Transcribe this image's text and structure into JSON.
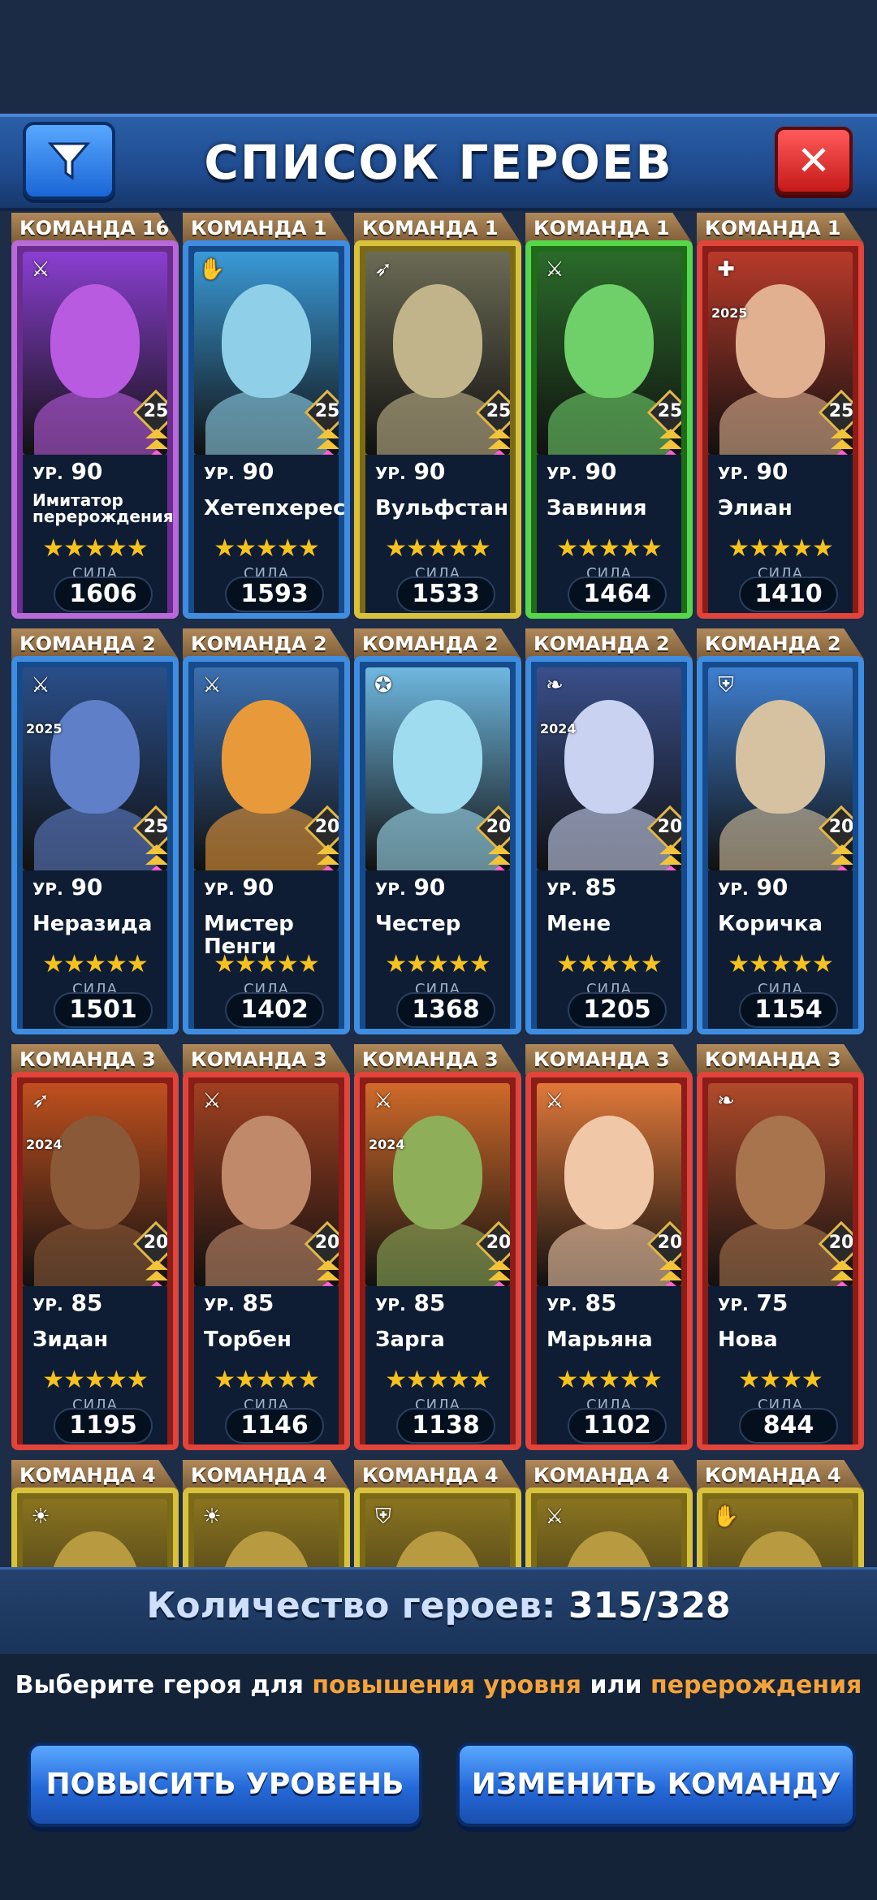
{
  "header": {
    "title": "СПИСОК ГЕРОЕВ",
    "filter_icon": "filter-funnel-icon",
    "close_label": "✕"
  },
  "heroes": [
    {
      "team": "КОМАНДА 16",
      "level": "90",
      "name": "Имитатор перерождения",
      "power": "1606",
      "stars": "★★★★★",
      "hero_level": "25",
      "frame": "legend",
      "class_icon": "⚔",
      "year": "",
      "bg": "#8a3fd1",
      "skin": "#b95be0"
    },
    {
      "team": "КОМАНДА 1",
      "level": "90",
      "name": "Хетепхерес",
      "power": "1593",
      "stars": "★★★★★",
      "hero_level": "25",
      "frame": "blue",
      "class_icon": "✋",
      "year": "",
      "bg": "#3a9ad8",
      "skin": "#8fd0e8"
    },
    {
      "team": "КОМАНДА 1",
      "level": "90",
      "name": "Вульфстан",
      "power": "1533",
      "stars": "★★★★★",
      "hero_level": "25",
      "frame": "yellow",
      "class_icon": "➶",
      "year": "",
      "bg": "#6b6b55",
      "skin": "#c2b48a"
    },
    {
      "team": "КОМАНДА 1",
      "level": "90",
      "name": "Завиния",
      "power": "1464",
      "stars": "★★★★★",
      "hero_level": "25",
      "frame": "green",
      "class_icon": "⚔",
      "year": "",
      "bg": "#2a6b2a",
      "skin": "#6fd06a"
    },
    {
      "team": "КОМАНДА 1",
      "level": "90",
      "name": "Элиан",
      "power": "1410",
      "stars": "★★★★★",
      "hero_level": "25",
      "frame": "red",
      "class_icon": "✚",
      "year": "2025",
      "bg": "#b83a2a",
      "skin": "#e0b090"
    },
    {
      "team": "КОМАНДА 2",
      "level": "90",
      "name": "Неразида",
      "power": "1501",
      "stars": "★★★★★",
      "hero_level": "25",
      "frame": "blue",
      "class_icon": "⚔",
      "year": "2025",
      "bg": "#2a4f8a",
      "skin": "#5f7fc8"
    },
    {
      "team": "КОМАНДА 2",
      "level": "90",
      "name": "Мистер Пенги",
      "power": "1402",
      "stars": "★★★★★",
      "hero_level": "20",
      "frame": "blue",
      "class_icon": "⚔",
      "year": "",
      "bg": "#3b6fb0",
      "skin": "#e89a3a"
    },
    {
      "team": "КОМАНДА 2",
      "level": "90",
      "name": "Честер",
      "power": "1368",
      "stars": "★★★★★",
      "hero_level": "20",
      "frame": "blue",
      "class_icon": "✪",
      "year": "",
      "bg": "#6fb8e0",
      "skin": "#9fdcf0"
    },
    {
      "team": "КОМАНДА 2",
      "level": "85",
      "name": "Мене",
      "power": "1205",
      "stars": "★★★★★",
      "hero_level": "20",
      "frame": "blue",
      "class_icon": "❧",
      "year": "2024",
      "bg": "#3a4f8a",
      "skin": "#c9d2f0"
    },
    {
      "team": "КОМАНДА 2",
      "level": "90",
      "name": "Коричка",
      "power": "1154",
      "stars": "★★★★★",
      "hero_level": "20",
      "frame": "blue",
      "class_icon": "⛨",
      "year": "",
      "bg": "#3f7fd0",
      "skin": "#d6c2a0"
    },
    {
      "team": "КОМАНДА 3",
      "level": "85",
      "name": "Зидан",
      "power": "1195",
      "stars": "★★★★★",
      "hero_level": "20",
      "frame": "red",
      "class_icon": "➶",
      "year": "2024",
      "bg": "#c0501e",
      "skin": "#8a5a38"
    },
    {
      "team": "КОМАНДА 3",
      "level": "85",
      "name": "Торбен",
      "power": "1146",
      "stars": "★★★★★",
      "hero_level": "20",
      "frame": "red",
      "class_icon": "⚔",
      "year": "",
      "bg": "#a04020",
      "skin": "#c08a6a"
    },
    {
      "team": "КОМАНДА 3",
      "level": "85",
      "name": "Зарга",
      "power": "1138",
      "stars": "★★★★★",
      "hero_level": "20",
      "frame": "red",
      "class_icon": "⚔",
      "year": "2024",
      "bg": "#d06a2a",
      "skin": "#8fae5a"
    },
    {
      "team": "КОМАНДА 3",
      "level": "85",
      "name": "Марьяна",
      "power": "1102",
      "stars": "★★★★★",
      "hero_level": "20",
      "frame": "red",
      "class_icon": "⚔",
      "year": "",
      "bg": "#e0783a",
      "skin": "#f0c8a8"
    },
    {
      "team": "КОМАНДА 3",
      "level": "75",
      "name": "Нова",
      "power": "844",
      "stars": "★★★★",
      "hero_level": "20",
      "frame": "red",
      "class_icon": "❧",
      "year": "",
      "bg": "#b04a2a",
      "skin": "#a8744e"
    },
    {
      "team": "КОМАНДА 4",
      "level": "",
      "name": "",
      "power": "",
      "stars": "",
      "hero_level": "",
      "frame": "yellow",
      "class_icon": "☀",
      "year": "",
      "bg": "#8a7420",
      "skin": "#b89a40"
    },
    {
      "team": "КОМАНДА 4",
      "level": "",
      "name": "",
      "power": "",
      "stars": "",
      "hero_level": "",
      "frame": "yellow",
      "class_icon": "☀",
      "year": "",
      "bg": "#8a7420",
      "skin": "#b89a40"
    },
    {
      "team": "КОМАНДА 4",
      "level": "",
      "name": "",
      "power": "",
      "stars": "",
      "hero_level": "",
      "frame": "yellow",
      "class_icon": "⛨",
      "year": "",
      "bg": "#8a7420",
      "skin": "#b89a40"
    },
    {
      "team": "КОМАНДА 4",
      "level": "",
      "name": "",
      "power": "",
      "stars": "",
      "hero_level": "",
      "frame": "yellow",
      "class_icon": "⚔",
      "year": "",
      "bg": "#8a7420",
      "skin": "#b89a40"
    },
    {
      "team": "КОМАНДА 4",
      "level": "",
      "name": "",
      "power": "",
      "stars": "",
      "hero_level": "",
      "frame": "yellow",
      "class_icon": "✋",
      "year": "",
      "bg": "#8a7420",
      "skin": "#b89a40"
    }
  ],
  "labels": {
    "level_prefix": "УР.",
    "power_label": "СИЛА"
  },
  "footer": {
    "count_label": "Количество героев:",
    "count_value": "315/328",
    "hint_prefix": "Выберите героя для",
    "hint_hl1": "повышения уровня",
    "hint_mid": "или",
    "hint_hl2": "перерождения",
    "level_up_button": "ПОВЫСИТЬ УРОВЕНЬ",
    "change_team_button": "ИЗМЕНИТЬ КОМАНДУ"
  }
}
